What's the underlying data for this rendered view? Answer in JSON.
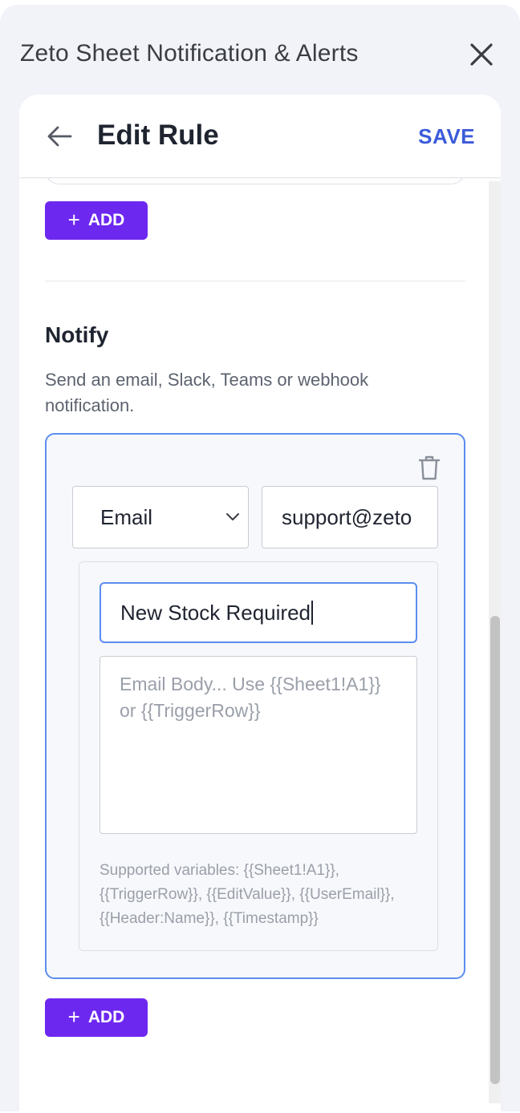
{
  "window": {
    "title": "Zeto Sheet Notification & Alerts",
    "close_icon": "close-icon"
  },
  "topbar": {
    "back_icon": "arrow-left-icon",
    "title": "Edit Rule",
    "save_label": "SAVE",
    "accent_color": "#3b5bd9"
  },
  "conditions": {
    "add_label": "ADD",
    "add_color": "#6d28f0"
  },
  "notify": {
    "title": "Notify",
    "description": "Send an email, Slack, Teams or webhook notification.",
    "channel_selected": "Email",
    "recipient_value": "support@zeto",
    "subject_value": "New Stock Required",
    "body_placeholder": "Email Body... Use {{Sheet1!A1}} or {{TriggerRow}}",
    "hint": "Supported variables: {{Sheet1!A1}}, {{TriggerRow}}, {{EditValue}}, {{UserEmail}}, {{Header:Name}}, {{Timestamp}}",
    "add_label": "ADD",
    "delete_icon": "trash-icon"
  }
}
